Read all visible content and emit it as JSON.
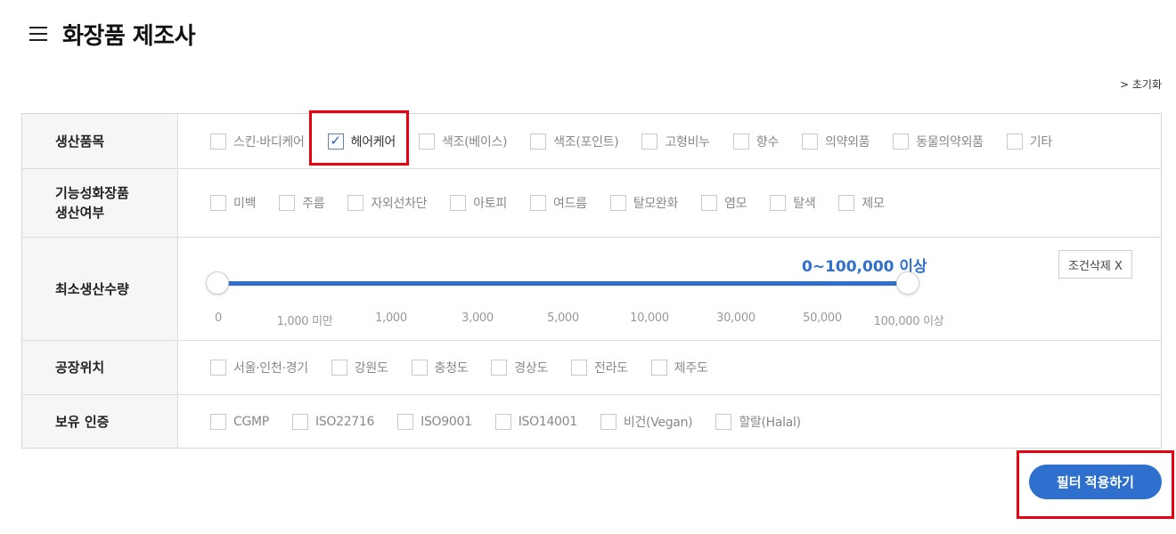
{
  "header": {
    "title": "화장품 제조사"
  },
  "reset_label": "> 초기화",
  "filters": {
    "products": {
      "label": "생산품목",
      "options": [
        "스킨·바디케어",
        "헤어케어",
        "색조(베이스)",
        "색조(포인트)",
        "고형비누",
        "향수",
        "의약외품",
        "동물의약외품",
        "기타"
      ],
      "checked": [
        "헤어케어"
      ]
    },
    "functional": {
      "label": "기능성화장품\n생산여부",
      "options": [
        "미백",
        "주름",
        "자외선차단",
        "아토피",
        "여드름",
        "탈모완화",
        "염모",
        "탈색",
        "제모"
      ]
    },
    "min_quantity": {
      "label": "최소생산수량",
      "value_text": "0~100,000 이상",
      "range": [
        0,
        100000
      ],
      "ticks": [
        "0",
        "1,000 미만",
        "1,000",
        "3,000",
        "5,000",
        "10,000",
        "30,000",
        "50,000",
        "100,000 이상"
      ],
      "clear_label": "조건삭제 X"
    },
    "factory": {
      "label": "공장위치",
      "options": [
        "서울·인천·경기",
        "강원도",
        "충청도",
        "경상도",
        "전라도",
        "제주도"
      ]
    },
    "certification": {
      "label": "보유 인증",
      "options": [
        "CGMP",
        "ISO22716",
        "ISO9001",
        "ISO14001",
        "비건(Vegan)",
        "할랄(Halal)"
      ]
    }
  },
  "apply_button": "필터 적용하기",
  "colors": {
    "accent": "#2f6fce",
    "highlight": "#e60012"
  },
  "icons": {
    "menu": "hamburger-menu-icon",
    "check": "checkmark-icon"
  }
}
